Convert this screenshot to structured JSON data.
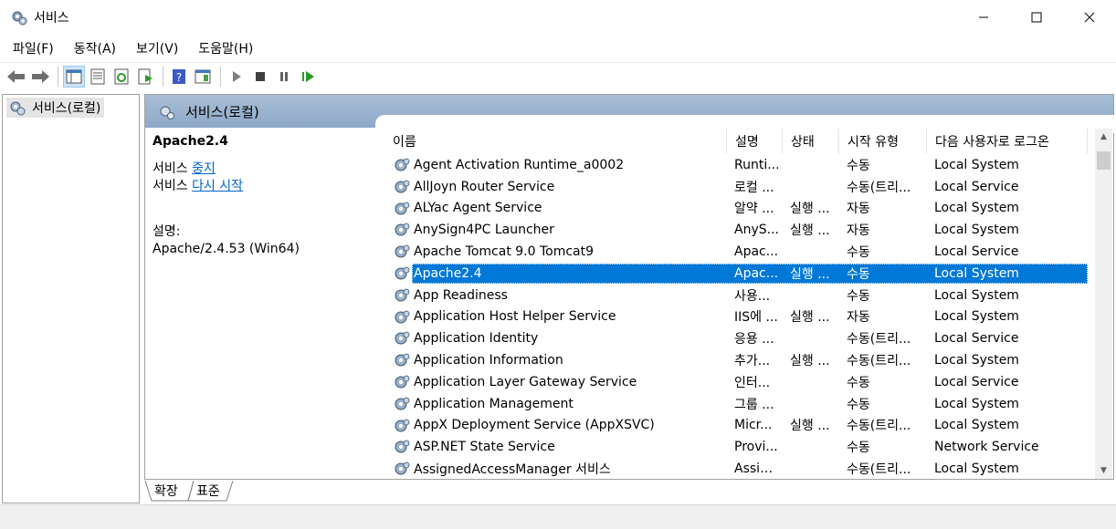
{
  "window": {
    "title": "서비스",
    "icon": "services-gear-icon"
  },
  "menu": [
    {
      "label": "파일(F)"
    },
    {
      "label": "동작(A)"
    },
    {
      "label": "보기(V)"
    },
    {
      "label": "도움말(H)"
    }
  ],
  "toolbar": [
    "back-icon",
    "forward-icon",
    "show-hide-tree-icon",
    "properties-icon",
    "refresh-icon",
    "export-list-icon",
    "help-icon",
    "show-action-pane-icon",
    "start-service-icon",
    "stop-service-icon",
    "pause-service-icon",
    "restart-service-icon"
  ],
  "tree": {
    "root_label": "서비스(로컬)"
  },
  "panel": {
    "header_title": "서비스(로컬)",
    "selected_service": "Apache2.4",
    "action_prefix": "서비스",
    "stop_link": "중지",
    "restart_link": "다시 시작",
    "desc_label": "설명:",
    "desc_text": "Apache/2.4.53 (Win64)"
  },
  "columns": {
    "name": "이름",
    "desc": "설명",
    "status": "상태",
    "start": "시작 유형",
    "logon": "다음 사용자로 로그온"
  },
  "rows": [
    {
      "name": "Agent Activation Runtime_a0002",
      "desc": "Runti...",
      "status": "",
      "start": "수동",
      "logon": "Local System"
    },
    {
      "name": "AllJoyn Router Service",
      "desc": "로컬 ...",
      "status": "",
      "start": "수동(트리...",
      "logon": "Local Service"
    },
    {
      "name": "ALYac Agent Service",
      "desc": "알약 ...",
      "status": "실행 ...",
      "start": "자동",
      "logon": "Local System"
    },
    {
      "name": "AnySign4PC Launcher",
      "desc": "AnyS...",
      "status": "실행 ...",
      "start": "자동",
      "logon": "Local System"
    },
    {
      "name": "Apache Tomcat 9.0 Tomcat9",
      "desc": "Apac...",
      "status": "",
      "start": "수동",
      "logon": "Local Service"
    },
    {
      "name": "Apache2.4",
      "desc": "Apac...",
      "status": "실행 ...",
      "start": "수동",
      "logon": "Local System",
      "selected": true
    },
    {
      "name": "App Readiness",
      "desc": "사용...",
      "status": "",
      "start": "수동",
      "logon": "Local System"
    },
    {
      "name": "Application Host Helper Service",
      "desc": "IIS에 ...",
      "status": "실행 ...",
      "start": "자동",
      "logon": "Local System"
    },
    {
      "name": "Application Identity",
      "desc": "응용 ...",
      "status": "",
      "start": "수동(트리...",
      "logon": "Local Service"
    },
    {
      "name": "Application Information",
      "desc": "추가...",
      "status": "실행 ...",
      "start": "수동(트리...",
      "logon": "Local System"
    },
    {
      "name": "Application Layer Gateway Service",
      "desc": "인터...",
      "status": "",
      "start": "수동",
      "logon": "Local Service"
    },
    {
      "name": "Application Management",
      "desc": "그룹 ...",
      "status": "",
      "start": "수동",
      "logon": "Local System"
    },
    {
      "name": "AppX Deployment Service (AppXSVC)",
      "desc": "Micr...",
      "status": "실행 ...",
      "start": "수동(트리...",
      "logon": "Local System"
    },
    {
      "name": "ASP.NET State Service",
      "desc": "Provi...",
      "status": "",
      "start": "수동",
      "logon": "Network Service"
    },
    {
      "name": "AssignedAccessManager 서비스",
      "desc": "Assig...",
      "status": "",
      "start": "수동(트리...",
      "logon": "Local System"
    }
  ],
  "tabs": [
    {
      "label": "확장",
      "active": true
    },
    {
      "label": "표준",
      "active": false
    }
  ],
  "colors": {
    "selection": "#0078d7",
    "header_band": "#9db4d0",
    "link": "#0066cc"
  }
}
